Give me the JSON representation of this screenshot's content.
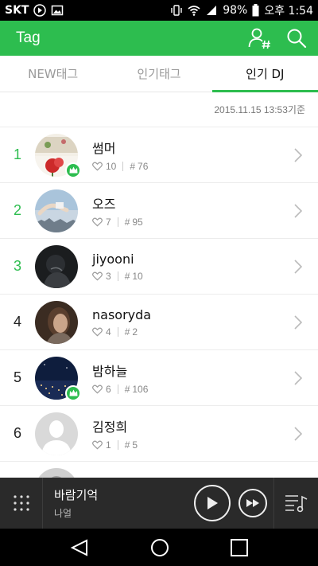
{
  "status_bar": {
    "carrier": "SKT",
    "battery": "98%",
    "time": "오후 1:54"
  },
  "app_bar": {
    "title": "Tag"
  },
  "tabs": [
    {
      "label": "NEW태그",
      "active": false
    },
    {
      "label": "인기태그",
      "active": false
    },
    {
      "label": "인기 DJ",
      "active": true
    }
  ],
  "timestamp": "2015.11.15 13:53기준",
  "dj_list": [
    {
      "rank": "1",
      "name": "썸머",
      "likes": "10",
      "tags": "76",
      "crown": true
    },
    {
      "rank": "2",
      "name": "오즈",
      "likes": "7",
      "tags": "95",
      "crown": false
    },
    {
      "rank": "3",
      "name": "jiyooni",
      "likes": "3",
      "tags": "10",
      "crown": false
    },
    {
      "rank": "4",
      "name": "nasoryda",
      "likes": "4",
      "tags": "2",
      "crown": false
    },
    {
      "rank": "5",
      "name": "밤하늘",
      "likes": "6",
      "tags": "106",
      "crown": true
    },
    {
      "rank": "6",
      "name": "김정희",
      "likes": "1",
      "tags": "5",
      "crown": false
    }
  ],
  "player": {
    "title": "바람기억",
    "artist": "나얼"
  },
  "colors": {
    "accent": "#2dbd4f",
    "player_bg": "#2a2a2a"
  }
}
